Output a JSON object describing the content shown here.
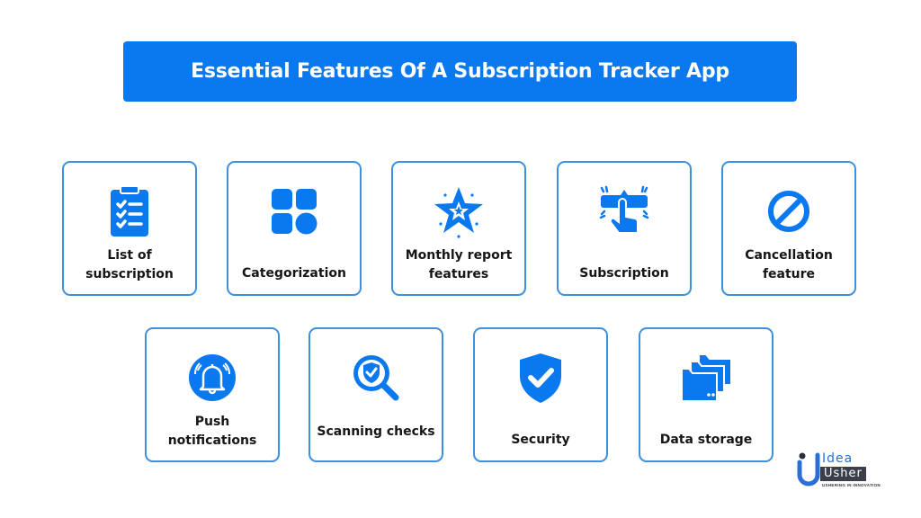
{
  "header": {
    "title": "Essential Features Of A Subscription Tracker App"
  },
  "colors": {
    "accent": "#0a78ef",
    "card_border": "#3d8fe0",
    "text": "#161616"
  },
  "features_row1": [
    {
      "label": "List of subscription",
      "icon": "clipboard-checklist-icon"
    },
    {
      "label": "Categorization",
      "icon": "category-grid-icon"
    },
    {
      "label": "Monthly report features",
      "icon": "star-icon"
    },
    {
      "label": "Subscription",
      "icon": "tap-button-icon"
    },
    {
      "label": "Cancellation feature",
      "icon": "prohibited-icon"
    }
  ],
  "features_row2": [
    {
      "label": "Push notifications",
      "icon": "bell-icon"
    },
    {
      "label": "Scanning checks",
      "icon": "magnifier-shield-icon"
    },
    {
      "label": "Security",
      "icon": "shield-check-icon"
    },
    {
      "label": "Data storage",
      "icon": "folders-icon"
    }
  ],
  "logo": {
    "line1": "Idea",
    "line2": "Usher",
    "tagline": "USHERING IN INNOVATION"
  }
}
